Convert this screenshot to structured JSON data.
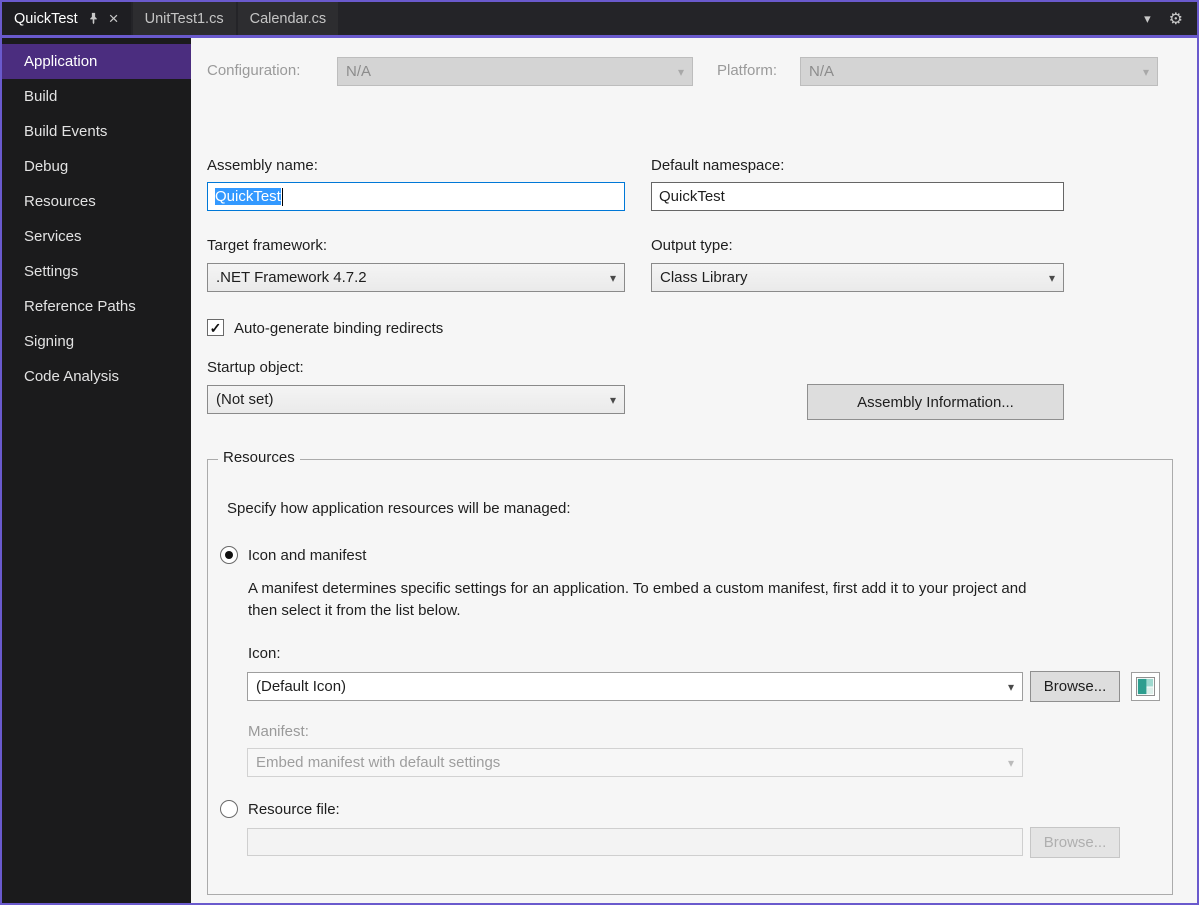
{
  "tabs": {
    "items": [
      {
        "label": "QuickTest",
        "active": true
      },
      {
        "label": "UnitTest1.cs",
        "active": false
      },
      {
        "label": "Calendar.cs",
        "active": false
      }
    ]
  },
  "sidebar": {
    "items": [
      {
        "label": "Application",
        "selected": true
      },
      {
        "label": "Build",
        "selected": false
      },
      {
        "label": "Build Events",
        "selected": false
      },
      {
        "label": "Debug",
        "selected": false
      },
      {
        "label": "Resources",
        "selected": false
      },
      {
        "label": "Services",
        "selected": false
      },
      {
        "label": "Settings",
        "selected": false
      },
      {
        "label": "Reference Paths",
        "selected": false
      },
      {
        "label": "Signing",
        "selected": false
      },
      {
        "label": "Code Analysis",
        "selected": false
      }
    ]
  },
  "toolbar": {
    "configuration_label": "Configuration:",
    "configuration_value": "N/A",
    "platform_label": "Platform:",
    "platform_value": "N/A"
  },
  "form": {
    "assembly_name_label": "Assembly name:",
    "assembly_name_value": "QuickTest",
    "default_namespace_label": "Default namespace:",
    "default_namespace_value": "QuickTest",
    "target_framework_label": "Target framework:",
    "target_framework_value": ".NET Framework 4.7.2",
    "output_type_label": "Output type:",
    "output_type_value": "Class Library",
    "auto_generate_label": "Auto-generate binding redirects",
    "auto_generate_checked": true,
    "startup_object_label": "Startup object:",
    "startup_object_value": "(Not set)",
    "assembly_info_button": "Assembly Information..."
  },
  "resources": {
    "legend": "Resources",
    "description": "Specify how application resources will be managed:",
    "icon_and_manifest_label": "Icon and manifest",
    "icon_and_manifest_selected": true,
    "manifest_help": "A manifest determines specific settings for an application. To embed a custom manifest, first add it to your project and then select it from the list below.",
    "icon_label": "Icon:",
    "icon_value": "(Default Icon)",
    "icon_browse_button": "Browse...",
    "manifest_label": "Manifest:",
    "manifest_value": "Embed manifest with default settings",
    "resource_file_label": "Resource file:",
    "resource_file_value": "",
    "resource_file_selected": false,
    "resource_browse_button": "Browse..."
  },
  "colors": {
    "accent": "#6A5ACD",
    "sidebar_selected": "#4B2D7F",
    "text_selection": "#3399FF"
  }
}
